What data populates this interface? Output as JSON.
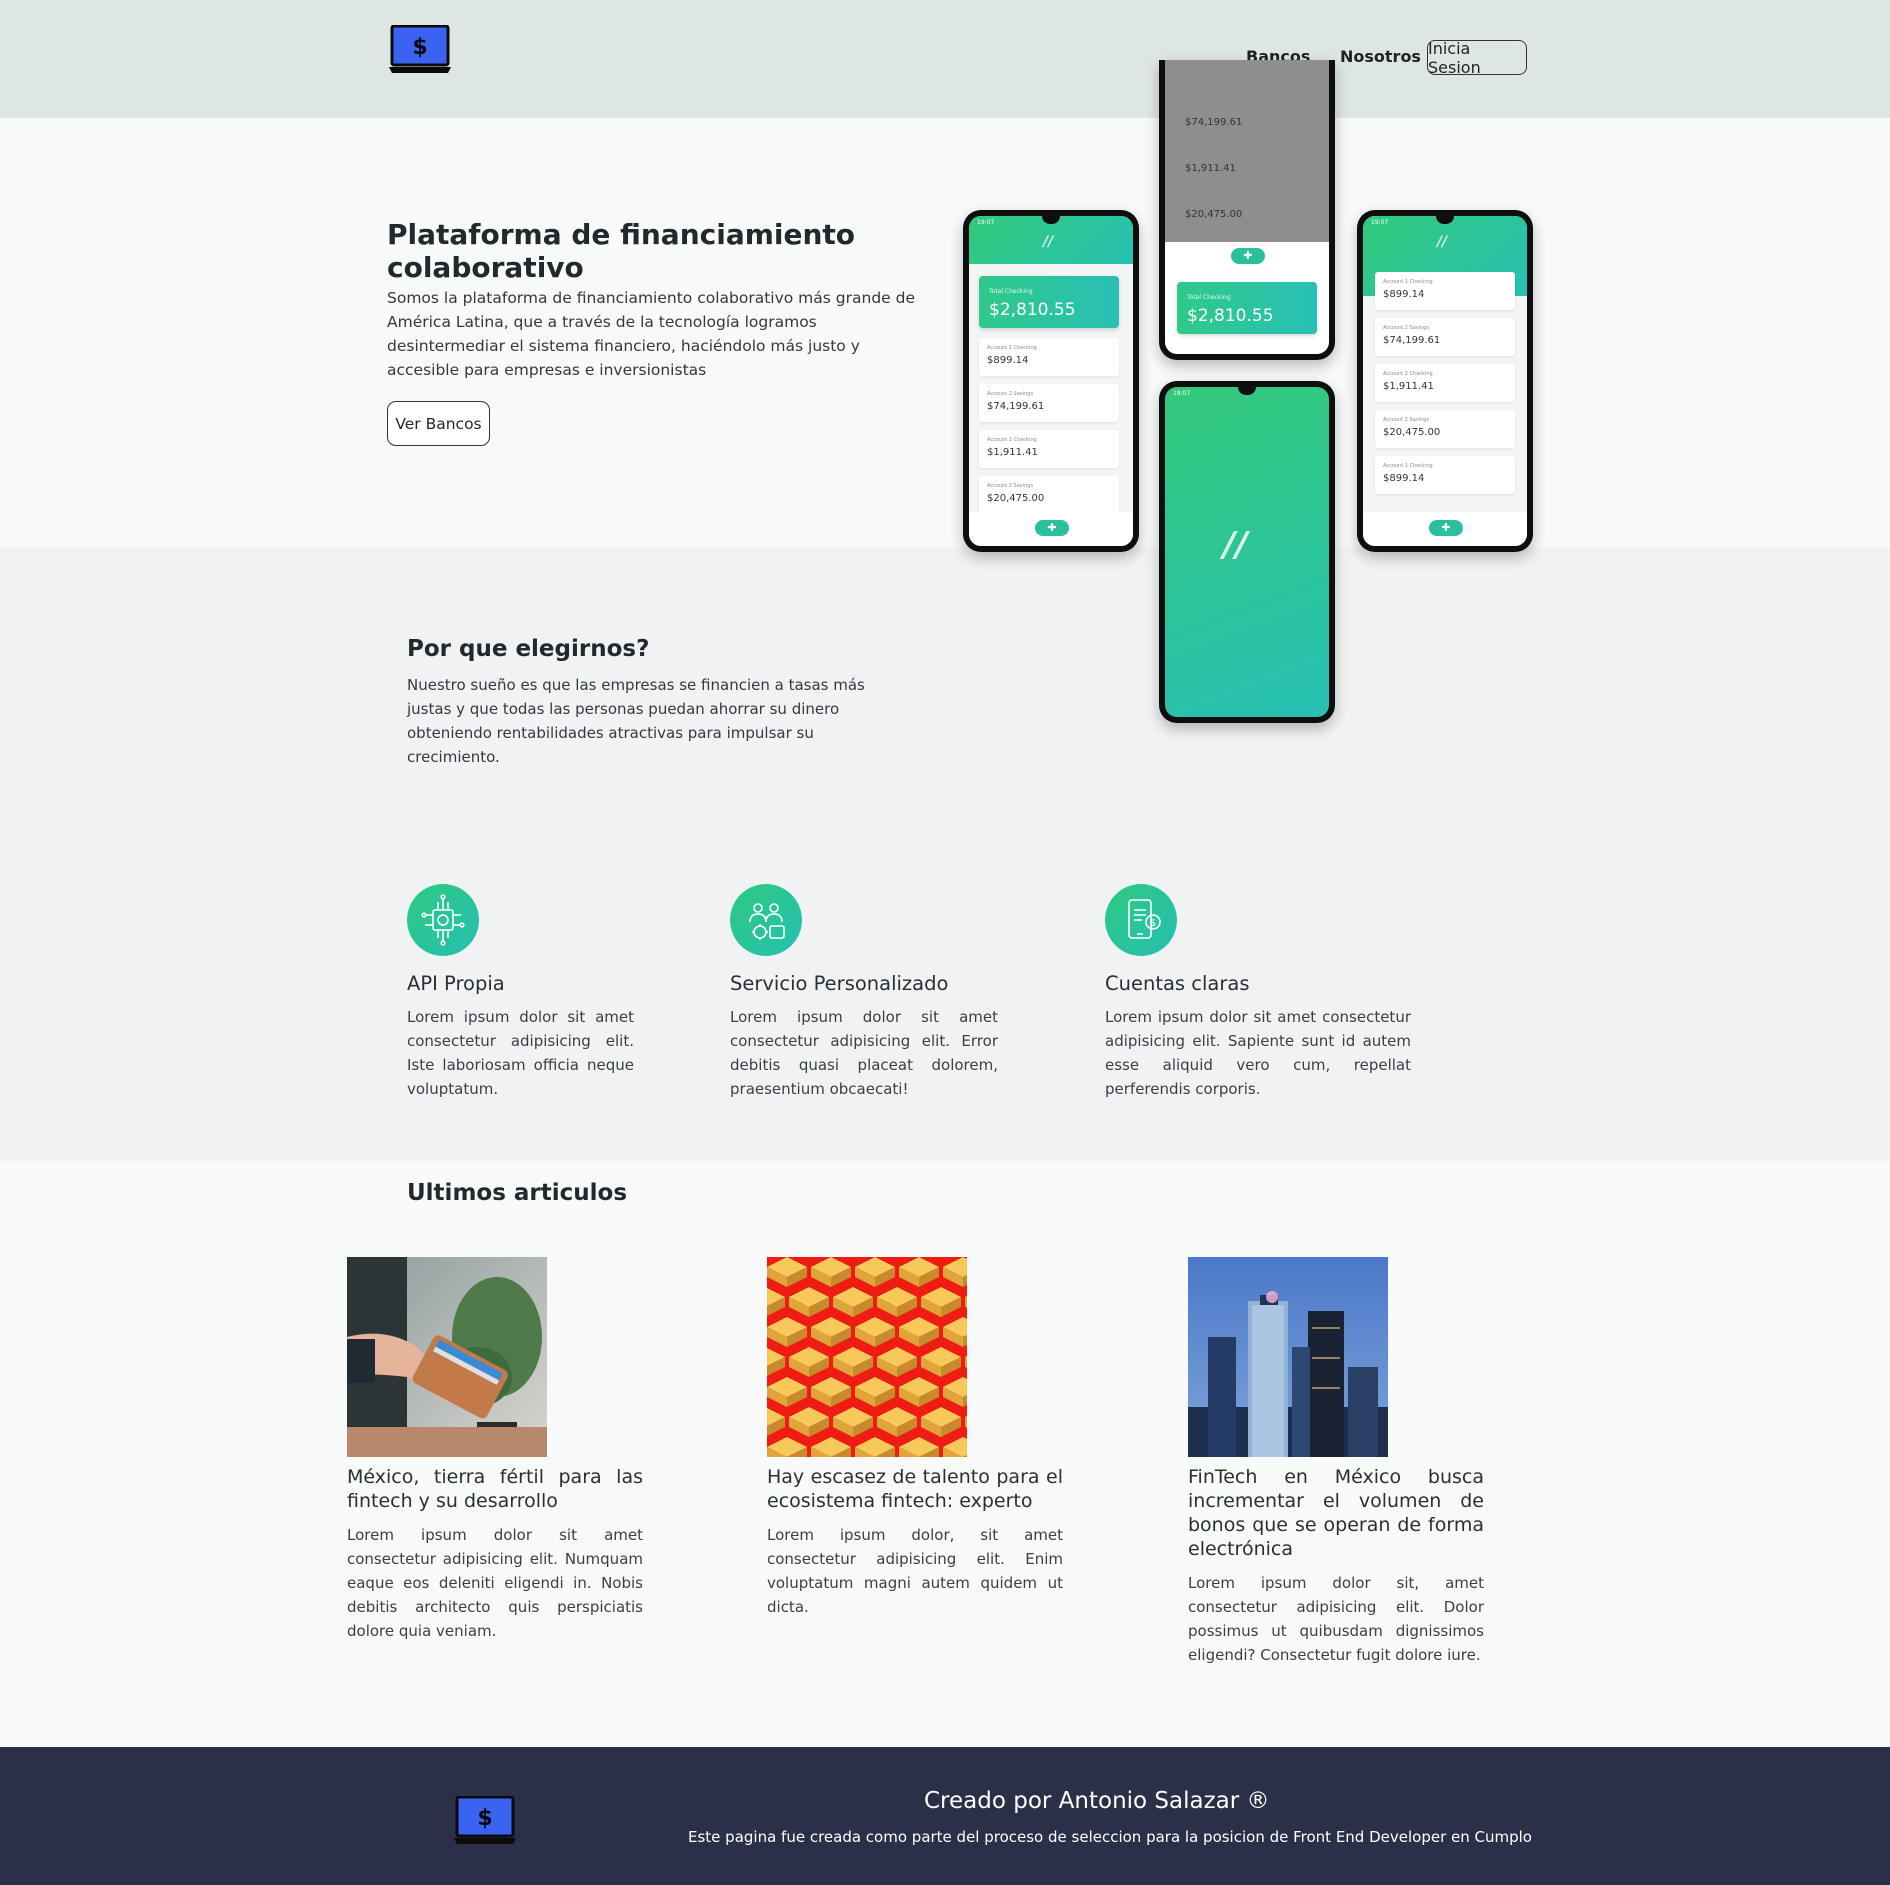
{
  "header": {
    "logo_name": "laptop-dollar-logo",
    "nav": {
      "bancos": "Bancos",
      "nosotros": "Nosotros",
      "login": "Inicia Sesion"
    }
  },
  "hero": {
    "title": "Plataforma de financiamiento colaborativo",
    "text": "Somos la plataforma de financiamiento colaborativo más grande de América Latina, que a través de la tecnología logramos desintermediar el sistema financiero, haciéndolo más justo y accesible para empresas e inversionistas",
    "button": "Ver Bancos",
    "phones": {
      "statusbar_time": "19:07",
      "total_label": "Total Checking",
      "total_value": "$2,810.55",
      "accounts": [
        {
          "label": "Account 1 Checking",
          "value": "$899.14"
        },
        {
          "label": "Account 2 Savings",
          "value": "$74,199.61"
        },
        {
          "label": "Account 2 Checking",
          "value": "$1,911.41"
        },
        {
          "label": "Account 2 Savings",
          "value": "$20,475.00"
        },
        {
          "label": "Account 1 Checking",
          "value": "$899.14"
        }
      ],
      "cut_value": "$20,475.00"
    }
  },
  "why": {
    "title": "Por que elegirnos?",
    "text": "Nuestro sueño es que las empresas se financien a tasas más justas y que todas las personas puedan ahorrar su dinero obteniendo rentabilidades atractivas para impulsar su crecimiento."
  },
  "features": [
    {
      "icon": "chip-circuit-icon",
      "title": "API Propia",
      "text": "Lorem ipsum dolor sit amet consectetur adipisicing elit. Iste laboriosam officia neque voluptatum."
    },
    {
      "icon": "people-service-icon",
      "title": "Servicio Personalizado",
      "text": "Lorem ipsum dolor sit amet consectetur adipisicing elit. Error debitis quasi placeat dolorem, praesentium obcaecati!"
    },
    {
      "icon": "mobile-bill-icon",
      "title": "Cuentas claras",
      "text": "Lorem ipsum dolor sit amet consectetur adipisicing elit. Sapiente sunt id autem esse aliquid vero cum, repellat perferendis corporis."
    }
  ],
  "articles": {
    "title": "Ultimos articulos",
    "items": [
      {
        "image": "hand-holding-wallet-photo",
        "title": "México, tierra fértil para las fintech y su desarrollo",
        "text": "Lorem ipsum dolor sit amet consectetur adipisicing elit. Numquam eaque eos deleniti eligendi in. Nobis debitis architecto quis perspiciatis dolore quia veniam."
      },
      {
        "image": "boxes-on-red-photo",
        "title": "Hay escasez de talento para el ecosistema fintech: experto",
        "text": "Lorem ipsum dolor, sit amet consectetur adipisicing elit. Enim voluptatum magni autem quidem ut dicta."
      },
      {
        "image": "city-skyscrapers-photo",
        "title": "FinTech en México busca incrementar el volumen de bonos que se operan de forma electrónica",
        "text": "Lorem ipsum dolor sit, amet consectetur adipisicing elit. Dolor possimus ut quibusdam dignissimos eligendi? Consectetur fugit dolore iure."
      }
    ]
  },
  "footer": {
    "title": "Creado por Antonio Salazar ®",
    "text": "Este pagina fue creada como parte del proceso de seleccion para la posicion de Front End Developer en Cumplo"
  },
  "colors": {
    "header_bg": "#dee6e4",
    "accent_green": "#2ec980",
    "accent_teal": "#26bfb3",
    "logo_blue": "#3b63f2",
    "footer_bg": "#2b3049"
  }
}
